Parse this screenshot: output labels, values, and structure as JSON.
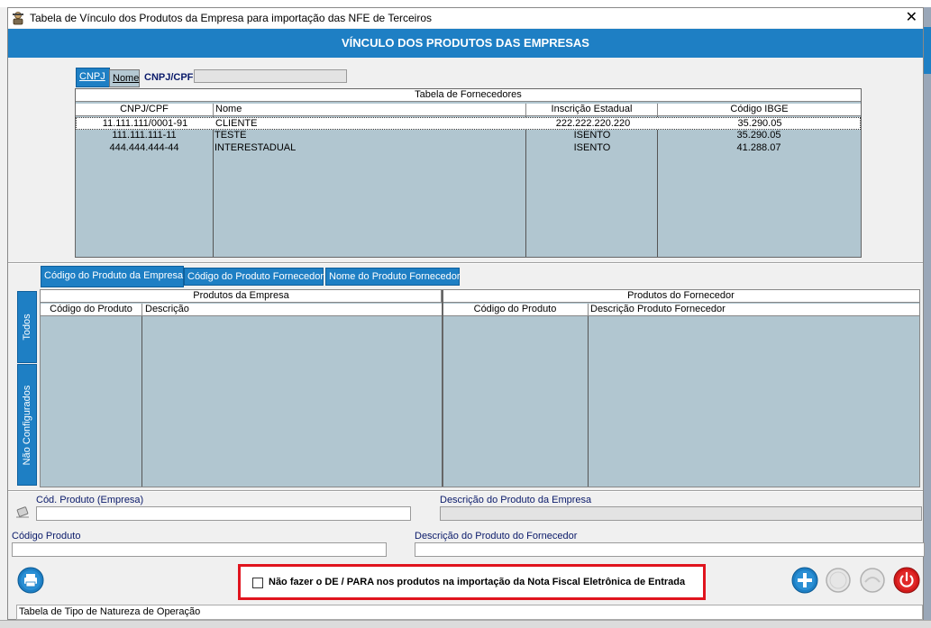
{
  "window": {
    "title": "Tabela de Vínculo dos Produtos da Empresa para importação das NFE de Terceiros",
    "close_label": "✕",
    "banner": "VÍNCULO DOS PRODUTOS DAS EMPRESAS"
  },
  "search": {
    "tabs": [
      "CNPJ",
      "Nome"
    ],
    "field_label": "CNPJ/CPF",
    "value": ""
  },
  "fornecedores": {
    "title": "Tabela de Fornecedores",
    "columns": [
      "CNPJ/CPF",
      "Nome",
      "Inscrição Estadual",
      "Código IBGE"
    ],
    "rows": [
      [
        "11.111.111/0001-91",
        "CLIENTE",
        "222.222.220.220",
        "35.290.05"
      ],
      [
        "111.111.111-11",
        "TESTE",
        "ISENTO",
        "35.290.05"
      ],
      [
        "444.444.444-44",
        "INTERESTADUAL",
        "ISENTO",
        "41.288.07"
      ]
    ]
  },
  "product_tabs": [
    "Código do Produto da Empresa",
    "Código do Produto Fornecedor",
    "Nome do Produto Fornecedor"
  ],
  "side_tabs": [
    "Todos",
    "Não Configurados"
  ],
  "produtos": {
    "empresa_title": "Produtos da Empresa",
    "fornecedor_title": "Produtos do Fornecedor",
    "empresa_columns": [
      "Código do Produto",
      "Descrição"
    ],
    "fornecedor_columns": [
      "Código do Produto",
      "Descrição Produto Fornecedor"
    ]
  },
  "form": {
    "cod_produto_empresa_label": "Cód. Produto (Empresa)",
    "cod_produto_empresa_value": "",
    "descricao_empresa_label": "Descrição do Produto da Empresa",
    "descricao_empresa_value": "",
    "codigo_produto_label": "Código Produto",
    "codigo_produto_value": "",
    "descricao_fornecedor_label": "Descrição do Produto do Fornecedor",
    "descricao_fornecedor_value": ""
  },
  "footer": {
    "checkbox_label": "Não fazer o DE / PARA nos produtos na importação da Nota Fiscal Eletrônica de Entrada",
    "checkbox_checked": false,
    "status_text": "Tabela de Tipo de Natureza de Operação"
  },
  "icons": {
    "print": "printer-icon",
    "add": "plus-icon",
    "power": "power-icon",
    "title": "app-icon",
    "eraser": "eraser-icon"
  },
  "colors": {
    "accent": "#1e7fc4",
    "grid_bg": "#b1c6d0",
    "highlight_border": "#e0141e",
    "power_red": "#d21a1a"
  }
}
